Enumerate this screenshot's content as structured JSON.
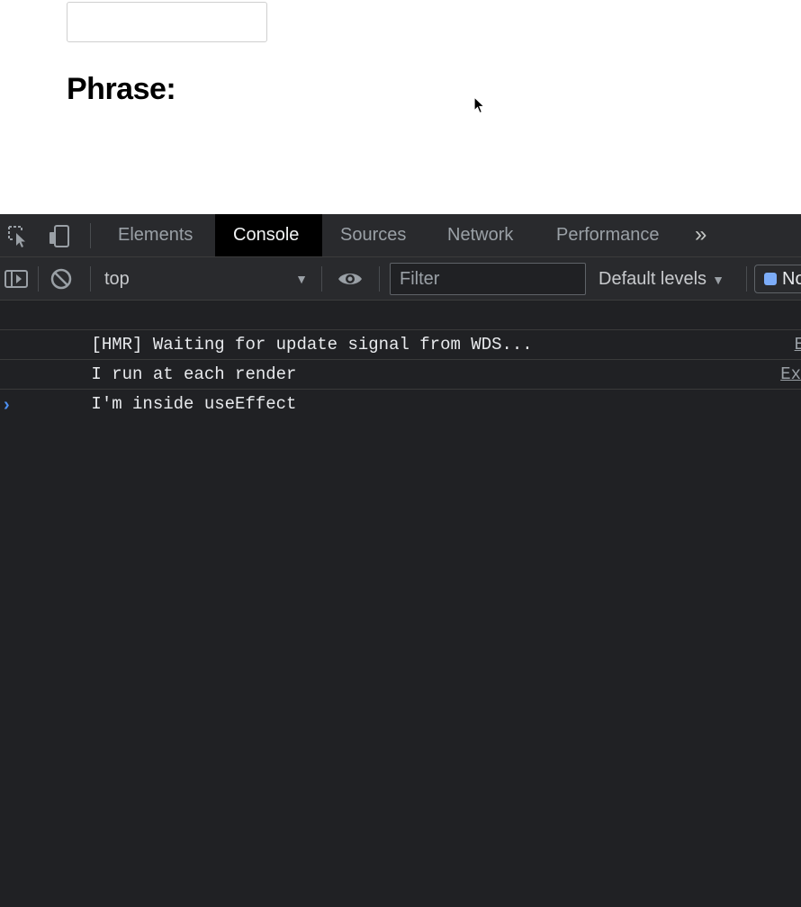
{
  "page": {
    "input_value": "",
    "heading": "Phrase:"
  },
  "devtools": {
    "tabs": [
      {
        "label": "Elements",
        "active": false
      },
      {
        "label": "Console",
        "active": true
      },
      {
        "label": "Sources",
        "active": false
      },
      {
        "label": "Network",
        "active": false
      },
      {
        "label": "Performance",
        "active": false
      }
    ],
    "toolbar": {
      "context": "top",
      "filter_placeholder": "Filter",
      "levels_label": "Default levels",
      "issues_label": "No Issues"
    },
    "console": {
      "messages": [
        {
          "text": "[HMR] Waiting for update signal from WDS...",
          "source": ""
        },
        {
          "text": "I run at each render",
          "source": "E"
        },
        {
          "text": "I'm inside useEffect",
          "source": "Ex"
        }
      ]
    },
    "colors": {
      "panel_bg": "#202124",
      "toolbar_bg": "#292a2d",
      "active_tab_bg": "#000000",
      "prompt_accent": "#4d8ff0"
    }
  }
}
